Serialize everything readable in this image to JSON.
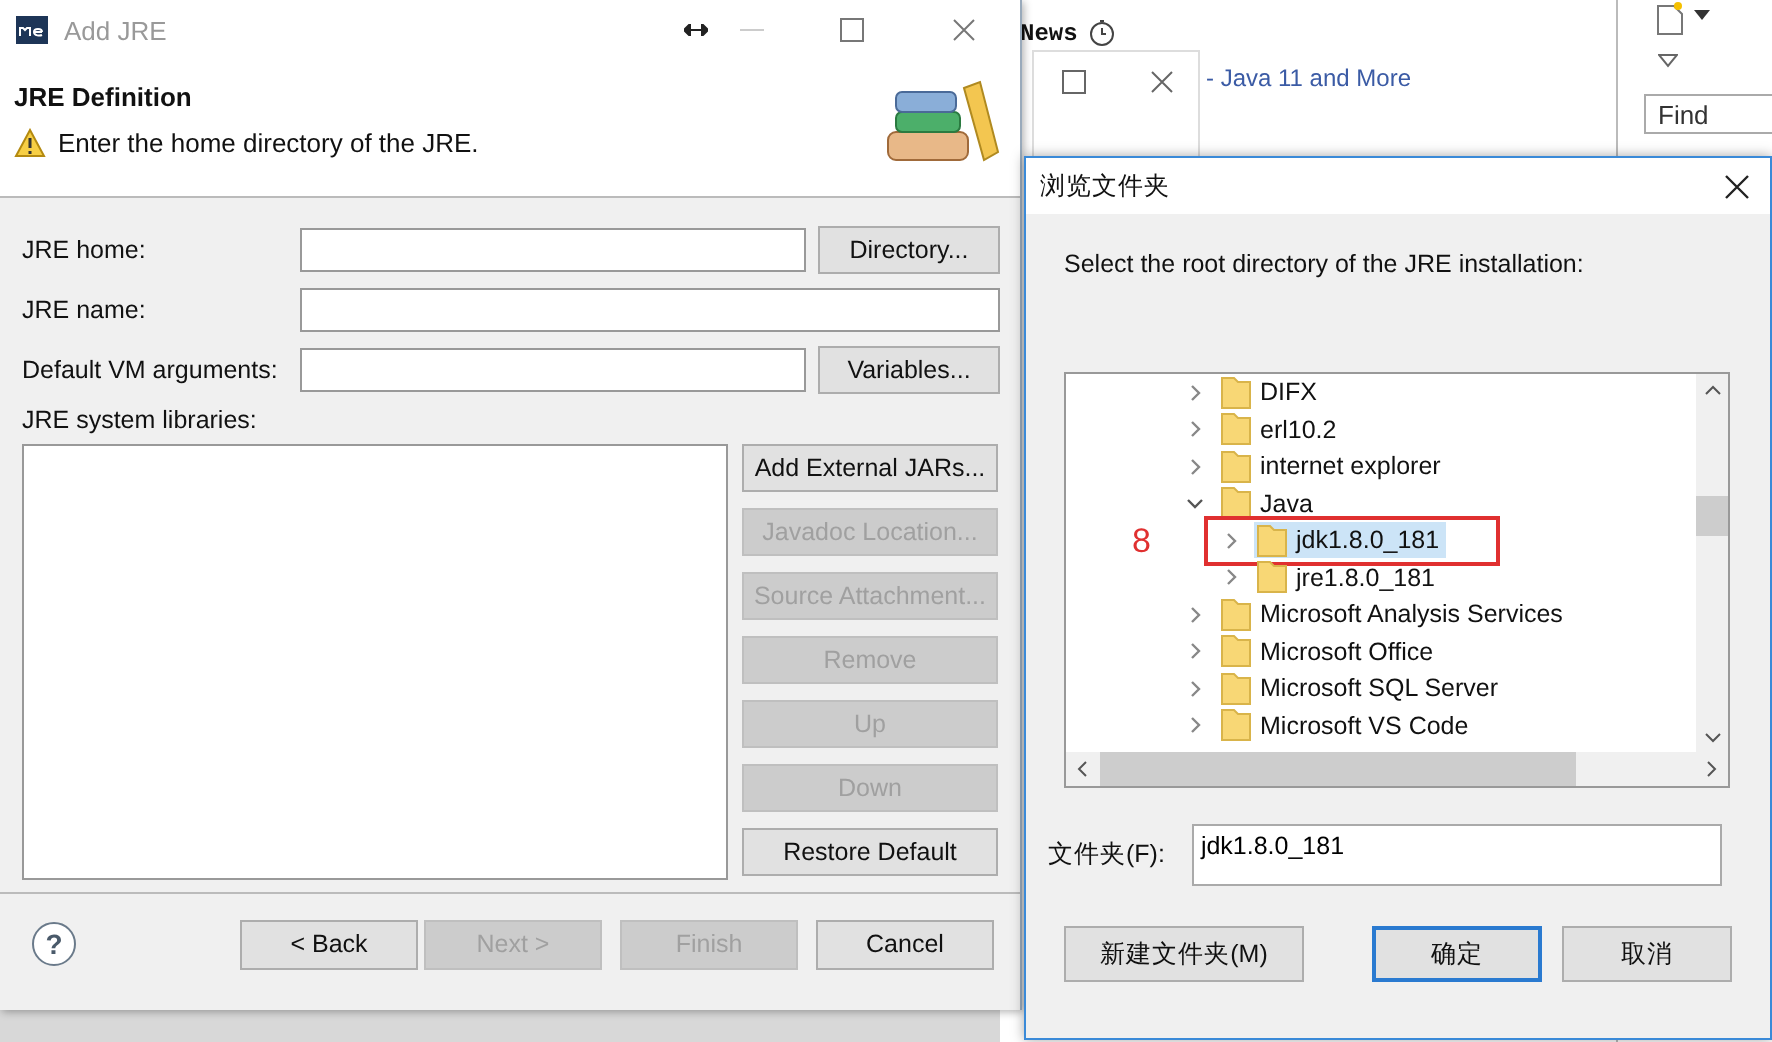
{
  "background": {
    "news_heading": "News",
    "link": "- Java 11 and More",
    "find_placeholder": "Find"
  },
  "add_jre": {
    "title": "Add JRE",
    "heading": "JRE Definition",
    "message": "Enter the home directory of the JRE.",
    "fields": [
      {
        "label": "JRE home:",
        "button": "Directory..."
      },
      {
        "label": "JRE name:"
      },
      {
        "label": "Default VM arguments:",
        "button": "Variables..."
      }
    ],
    "libraries_label": "JRE system libraries:",
    "library_buttons": [
      {
        "label": "Add External JARs...",
        "disabled": false
      },
      {
        "label": "Javadoc Location...",
        "disabled": true
      },
      {
        "label": "Source Attachment...",
        "disabled": true
      },
      {
        "label": "Remove",
        "disabled": true
      },
      {
        "label": "Up",
        "disabled": true
      },
      {
        "label": "Down",
        "disabled": true
      },
      {
        "label": "Restore Default",
        "disabled": false
      }
    ],
    "help_icon": "?",
    "footer_buttons": [
      {
        "label": "< Back",
        "disabled": false
      },
      {
        "label": "Next >",
        "disabled": true
      },
      {
        "label": "Finish",
        "disabled": true
      },
      {
        "label": "Cancel",
        "disabled": false
      }
    ]
  },
  "browse": {
    "title": "浏览文件夹",
    "instruction": "Select the root directory of the JRE installation:",
    "tree": [
      {
        "label": "DIFX",
        "expanded": false,
        "selected": false
      },
      {
        "label": "erl10.2",
        "expanded": false,
        "selected": false
      },
      {
        "label": "internet explorer",
        "expanded": false,
        "selected": false
      },
      {
        "label": "Java",
        "expanded": true,
        "selected": false,
        "children": [
          {
            "label": "jdk1.8.0_181",
            "expanded": false,
            "selected": true,
            "annotation": "8"
          },
          {
            "label": "jre1.8.0_181",
            "expanded": false,
            "selected": false
          }
        ]
      },
      {
        "label": "Microsoft Analysis Services",
        "expanded": false,
        "selected": false
      },
      {
        "label": "Microsoft Office",
        "expanded": false,
        "selected": false
      },
      {
        "label": "Microsoft SQL Server",
        "expanded": false,
        "selected": false
      },
      {
        "label": "Microsoft VS Code",
        "expanded": false,
        "selected": false
      }
    ],
    "folder_label": "文件夹(F):",
    "folder_value": "jdk1.8.0_181",
    "buttons": [
      {
        "label": "新建文件夹(M)",
        "default": false
      },
      {
        "label": "确定",
        "default": true
      },
      {
        "label": "取消",
        "default": false
      }
    ]
  }
}
